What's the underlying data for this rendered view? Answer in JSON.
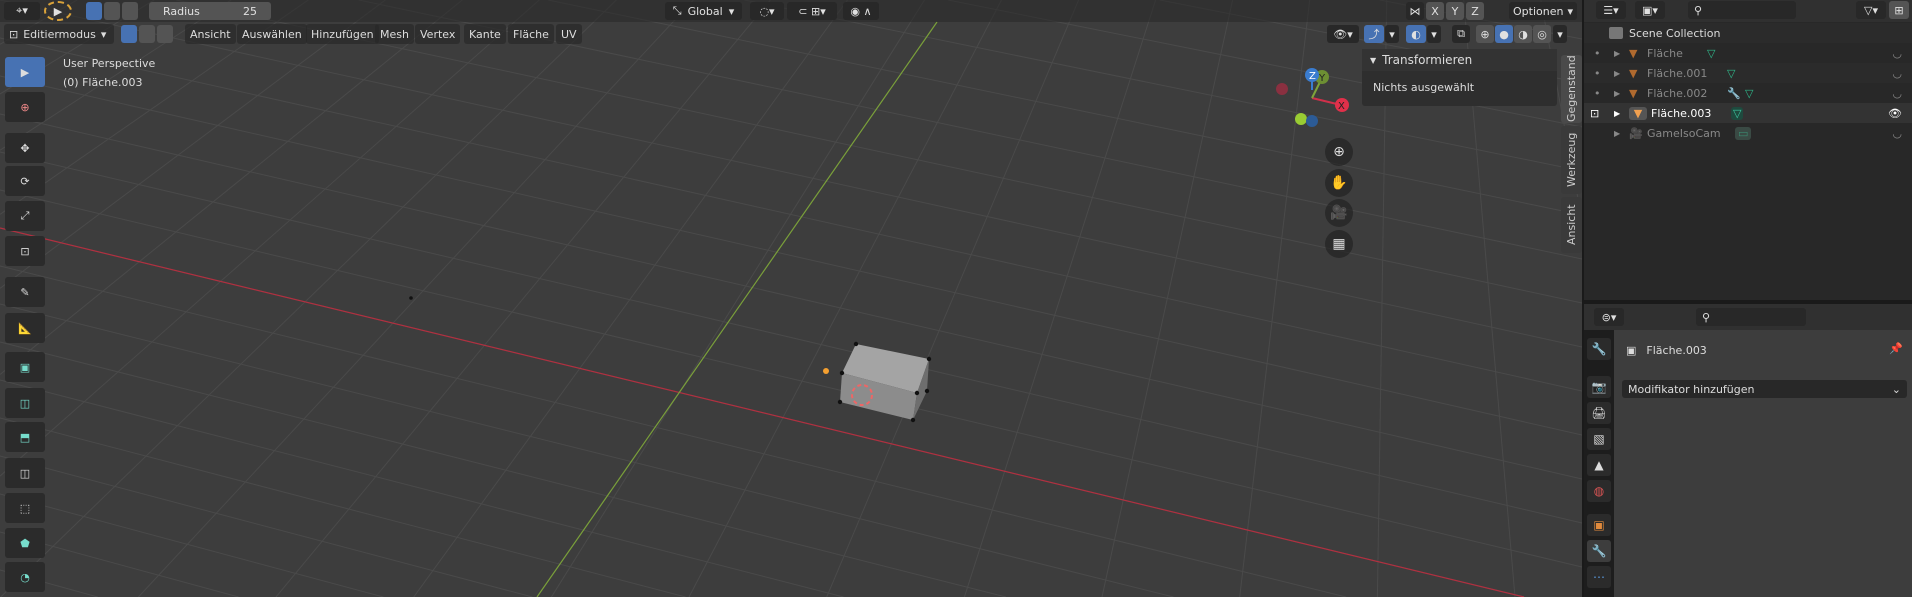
{
  "header": {
    "radius_label": "Radius",
    "radius_value": "25",
    "orientation": "Global",
    "axes": [
      "X",
      "Y",
      "Z"
    ],
    "options_label": "Optionen"
  },
  "menubar": {
    "mode": "Editiermodus",
    "menus": [
      "Ansicht",
      "Auswählen",
      "Hinzufügen",
      "Mesh",
      "Vertex",
      "Kante",
      "Fläche",
      "UV"
    ]
  },
  "viewport": {
    "view_name": "User Perspective",
    "object_info": "(0) Fläche.003",
    "gizmo_axes": [
      "Z",
      "Y",
      "X"
    ]
  },
  "n_panel": {
    "panel_title": "Transformieren",
    "panel_text": "Nichts ausgewählt",
    "tabs": [
      "Gegenstand",
      "Werkzeug",
      "Ansicht"
    ]
  },
  "outliner": {
    "scene_collection": "Scene Collection",
    "items": [
      {
        "name": "Fläche",
        "active": false
      },
      {
        "name": "Fläche.001",
        "active": false
      },
      {
        "name": "Fläche.002",
        "active": false
      },
      {
        "name": "Fläche.003",
        "active": true
      },
      {
        "name": "GameIsoCam",
        "active": false
      }
    ]
  },
  "properties": {
    "object_name": "Fläche.003",
    "add_modifier": "Modifikator hinzufügen"
  },
  "colors": {
    "accent": "#4772b3",
    "x_axis": "#c4354a",
    "y_axis": "#7ea53a",
    "z_axis": "#3a7ccf",
    "object_orange": "#e08a3c",
    "mesh_green": "#3ec7a0"
  }
}
